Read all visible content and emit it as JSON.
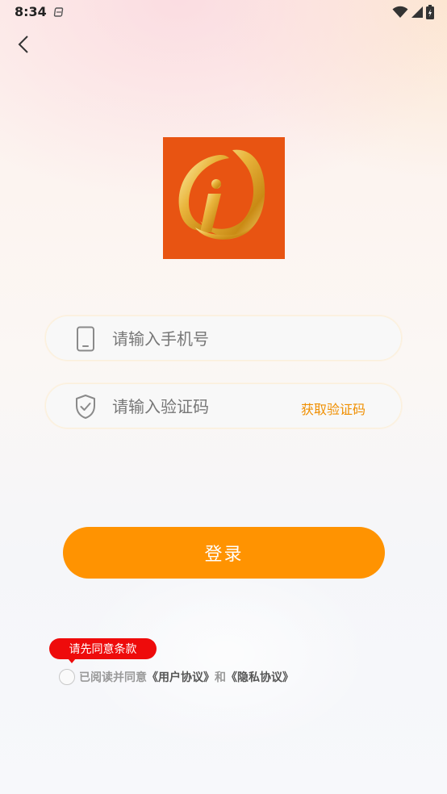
{
  "status_bar": {
    "time": "8:34"
  },
  "login_form": {
    "phone_placeholder": "请输入手机号",
    "code_placeholder": "请输入验证码",
    "get_code_label": "获取验证码",
    "login_button_label": "登录"
  },
  "agreement": {
    "tooltip": "请先同意条款",
    "prefix": "已阅读并同意",
    "user_agreement": "《用户协议》",
    "and": "和",
    "privacy_policy": "《隐私协议》"
  },
  "colors": {
    "accent": "#ff9301",
    "logo_bg": "#e85412",
    "tooltip_bg": "#ee0b0b",
    "link_text": "#f08f00"
  },
  "icons": [
    "back-icon",
    "phone-icon",
    "shield-check-icon",
    "wifi-icon",
    "signal-icon",
    "battery-icon",
    "notification-icon"
  ]
}
